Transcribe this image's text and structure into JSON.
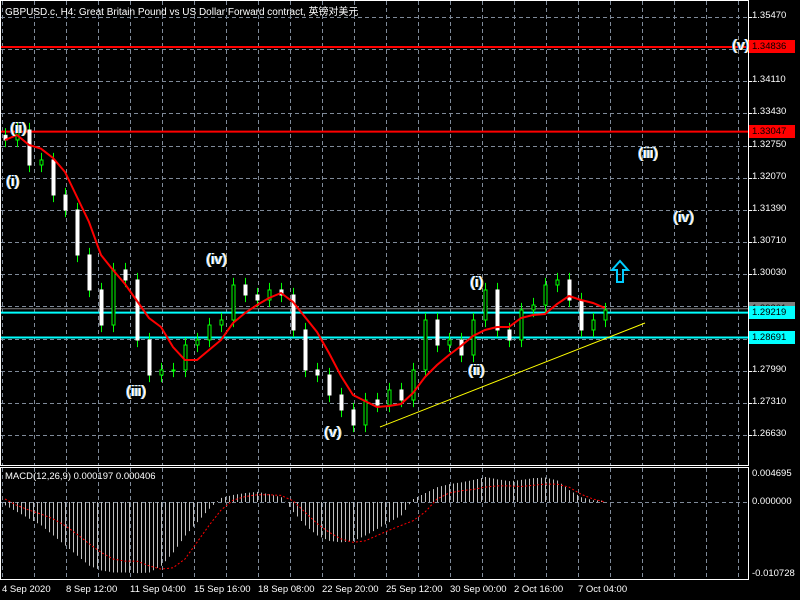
{
  "header": {
    "title": "GBPUSD.c, H4:  Great Britain Pound vs US Dollar Forward contract, 英镑对美元"
  },
  "colors": {
    "bull": "#00ff00",
    "bear": "#ffffff",
    "ma": "#ff0000",
    "hline_red": "#ff0000",
    "hline_cyan": "#00ffff",
    "trend": "#ffff00",
    "grid": "#7f8a99"
  },
  "price_axis": {
    "ticks": [
      "1.35470",
      "1.34110",
      "1.33430",
      "1.32750",
      "1.32070",
      "1.31390",
      "1.30710",
      "1.30030",
      "1.27990",
      "1.27310",
      "1.26630"
    ],
    "tags": [
      {
        "value": "1.34836",
        "color": "#ff0000",
        "text_color": "#ff0000"
      },
      {
        "value": "1.33047",
        "color": "#ff0000",
        "text_color": "#ff0000"
      },
      {
        "value": "1.29301",
        "color": "#808080",
        "text_color": "#000000"
      },
      {
        "value": "1.29219",
        "color": "#00ffff",
        "text_color": "#000000"
      },
      {
        "value": "1.28691",
        "color": "#00ffff",
        "text_color": "#000000"
      }
    ]
  },
  "waves": [
    "(ii)",
    "(i)",
    "(iii)",
    "(iv)",
    "(v)",
    "(i)",
    "(ii)",
    "(iii)",
    "(iv)",
    "(v)"
  ],
  "time_axis": [
    "4 Sep 2020",
    "8 Sep 12:00",
    "11 Sep 04:00",
    "15 Sep 16:00",
    "18 Sep 08:00",
    "22 Sep 20:00",
    "25 Sep 12:00",
    "30 Sep 00:00",
    "2 Oct 16:00",
    "7 Oct 04:00"
  ],
  "macd": {
    "title": "MACD(12,26,9) 0.000197 0.000406",
    "ticks": [
      "0.004695",
      "0.000000",
      "-0.010728"
    ]
  },
  "chart_data": {
    "type": "candlestick",
    "symbol": "GBPUSD.c",
    "timeframe": "H4",
    "ylim": [
      1.263,
      1.358
    ],
    "close": [
      1.32869,
      1.3308,
      1.3234,
      1.32446,
      1.31706,
      1.31388,
      1.30437,
      1.29697,
      1.28956,
      1.3012,
      1.29908,
      1.28639,
      1.27899,
      1.28005,
      1.28005,
      1.28533,
      1.28639,
      1.28956,
      1.29062,
      1.29802,
      1.29591,
      1.29485,
      1.29697,
      1.29591,
      1.28851,
      1.28005,
      1.27899,
      1.27476,
      1.27159,
      1.26842,
      1.2737,
      1.27265,
      1.27582,
      1.2737,
      1.28005,
      1.29062,
      1.28533,
      1.28639,
      1.28322,
      1.29062,
      1.29697,
      1.28851,
      1.28639,
      1.29274,
      1.29379,
      1.29802,
      1.29908,
      1.29485,
      1.28851,
      1.29062,
      1.29274
    ],
    "hlines": [
      1.34836,
      1.33047,
      1.29219,
      1.28691
    ],
    "macd_hist": [
      -0.0005,
      -0.0015,
      -0.0025,
      -0.0035,
      -0.005,
      -0.0065,
      -0.008,
      -0.0095,
      -0.0102,
      -0.0105,
      -0.0105,
      -0.0106,
      -0.0105,
      -0.0095,
      -0.0075,
      -0.005,
      -0.003,
      -0.001,
      0.0007,
      0.0012,
      0.0015,
      0.0017,
      0.0013,
      0.0008,
      -0.0015,
      -0.0035,
      -0.005,
      -0.0058,
      -0.006,
      -0.0058,
      -0.005,
      -0.004,
      -0.003,
      -0.002,
      0.0005,
      0.0015,
      0.0025,
      0.003,
      0.0033,
      0.0037,
      0.0042,
      0.0038,
      0.0035,
      0.0037,
      0.004,
      0.0041,
      0.0036,
      0.002,
      0.0008,
      0.0003,
      0.0002
    ],
    "macd_signal": [
      0.0005,
      -0.0005,
      -0.0012,
      -0.0018,
      -0.0025,
      -0.0035,
      -0.0048,
      -0.0062,
      -0.0075,
      -0.0085,
      -0.0088,
      -0.0088,
      -0.0095,
      -0.01,
      -0.0098,
      -0.0085,
      -0.006,
      -0.0035,
      -0.0012,
      0.0003,
      0.0009,
      0.0012,
      0.0012,
      0.0011,
      0.0002,
      -0.0015,
      -0.0032,
      -0.0045,
      -0.0055,
      -0.006,
      -0.0058,
      -0.005,
      -0.0042,
      -0.0035,
      -0.0028,
      -0.0015,
      0.0005,
      0.0015,
      0.0019,
      0.0021,
      0.0025,
      0.0027,
      0.0027,
      0.0026,
      0.0028,
      0.003,
      0.003,
      0.0025,
      0.0013,
      0.0005,
      0.0
    ],
    "macd_ylim": [
      -0.010728,
      0.004695
    ]
  }
}
